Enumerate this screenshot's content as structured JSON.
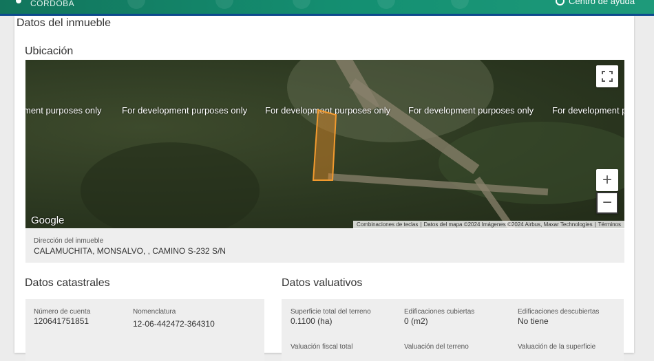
{
  "header": {
    "logo_text": "CÓRDOBA",
    "help_label": "Centro de ayuda"
  },
  "page": {
    "title": "Datos del inmueble"
  },
  "ubicacion": {
    "title": "Ubicación",
    "map": {
      "watermark": "For development purposes only",
      "google_label": "Google",
      "attribution": {
        "shortcuts": "Combinaciones de teclas",
        "data": "Datos del mapa ©2024 Imágenes ©2024 Airbus, Maxar Technologies",
        "terms": "Términos"
      },
      "zoom_in": "+",
      "zoom_out": "−"
    },
    "address_label": "Dirección del inmueble",
    "address_value": "CALAMUCHITA, MONSALVO, , CAMINO S-232 S/N"
  },
  "catastrales": {
    "title": "Datos catastrales",
    "fields": [
      {
        "label": "Número de cuenta",
        "value": "120641751851"
      },
      {
        "label": "Nomenclatura",
        "value": "12-06-442472-364310"
      }
    ]
  },
  "valuativos": {
    "title": "Datos valuativos",
    "fields": [
      {
        "label": "Superficie total del terreno",
        "value": "0.1100 (ha)"
      },
      {
        "label": "Edificaciones cubiertas",
        "value": "0 (m2)"
      },
      {
        "label": "Edificaciones descubiertas",
        "value": "No tiene"
      }
    ],
    "fields_row2": [
      {
        "label": "Valuación fiscal total"
      },
      {
        "label": "Valuación del terreno"
      },
      {
        "label": "Valuación de la superficie"
      }
    ]
  }
}
